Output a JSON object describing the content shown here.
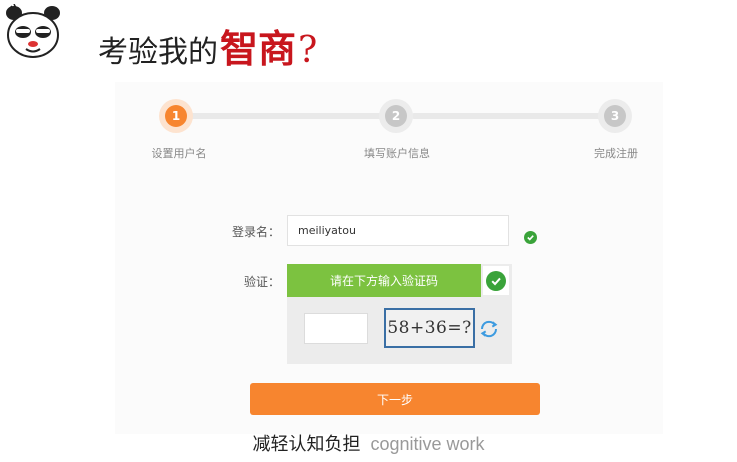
{
  "header": {
    "title_plain": "考验我的",
    "title_accent": "智商",
    "title_suffix": "?"
  },
  "steps": [
    {
      "number": "1",
      "label": "设置用户名",
      "state": "active"
    },
    {
      "number": "2",
      "label": "填写账户信息",
      "state": "idle"
    },
    {
      "number": "3",
      "label": "完成注册",
      "state": "idle"
    }
  ],
  "form": {
    "username_label": "登录名：",
    "username_value": "meiliyatou",
    "verify_label": "验证：",
    "verify_prompt": "请在下方输入验证码",
    "captcha_text": "58+36=?",
    "next_label": "下一步"
  },
  "caption": {
    "cn": "减轻认知负担",
    "en": "cognitive work"
  },
  "colors": {
    "accent_orange": "#f7852f",
    "verify_green": "#7cc240",
    "check_green": "#3aa33a",
    "title_red": "#c8161d"
  }
}
